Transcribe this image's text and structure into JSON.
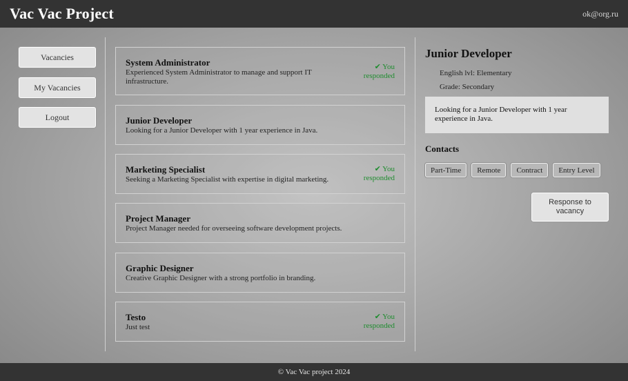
{
  "header": {
    "title": "Vac Vac Project",
    "user_email": "ok@org.ru"
  },
  "sidebar": {
    "items": [
      {
        "label": "Vacancies"
      },
      {
        "label": "My Vacancies"
      },
      {
        "label": "Logout"
      }
    ]
  },
  "vacancies": [
    {
      "title": "System Administrator",
      "description": "Experienced System Administrator to manage and support IT infrastructure.",
      "responded": "✔ You responded"
    },
    {
      "title": "Junior Developer",
      "description": "Looking for a Junior Developer with 1 year experience in Java.",
      "responded": ""
    },
    {
      "title": "Marketing Specialist",
      "description": "Seeking a Marketing Specialist with expertise in digital marketing.",
      "responded": "✔ You responded"
    },
    {
      "title": "Project Manager",
      "description": "Project Manager needed for overseeing software development projects.",
      "responded": ""
    },
    {
      "title": "Graphic Designer",
      "description": "Creative Graphic Designer with a strong portfolio in branding.",
      "responded": ""
    },
    {
      "title": "Testo",
      "description": "Just test",
      "responded": "✔ You responded"
    }
  ],
  "detail": {
    "title": "Junior Developer",
    "english": "English lvl: Elementary",
    "grade": "Grade: Secondary",
    "description": "Looking for a Junior Developer with 1 year experience in Java.",
    "contacts_label": "Contacts",
    "tags": [
      "Part-Time",
      "Remote",
      "Contract",
      "Entry Level"
    ],
    "response_button": "Response to vacancy"
  },
  "footer": {
    "text": "© Vac Vac project 2024"
  },
  "colors": {
    "bar": "#333333",
    "responded": "#1e8c2e"
  }
}
